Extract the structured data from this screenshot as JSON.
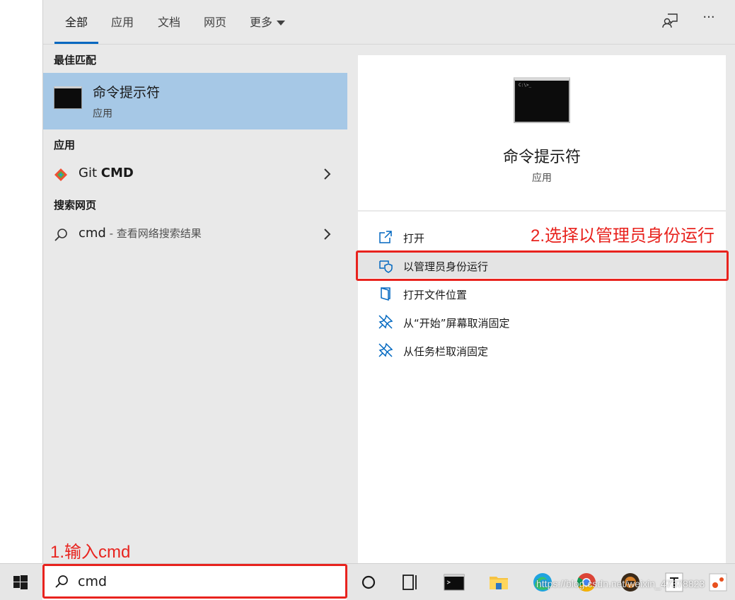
{
  "tabs": [
    {
      "label": "全部"
    },
    {
      "label": "应用"
    },
    {
      "label": "文档"
    },
    {
      "label": "网页"
    },
    {
      "label": "更多"
    }
  ],
  "header_icons": [
    "feedback-icon",
    "more-options-icon"
  ],
  "more_glyph": "···",
  "best_match": {
    "section_title": "最佳匹配",
    "name": "命令提示符",
    "type": "应用"
  },
  "apps": {
    "section_title": "应用",
    "items": [
      {
        "name_prefix": "Git ",
        "name_bold": "CMD"
      }
    ]
  },
  "web": {
    "section_title": "搜索网页",
    "items": [
      {
        "query": "cmd",
        "suffix": " - 查看网络搜索结果"
      }
    ]
  },
  "detail": {
    "name": "命令提示符",
    "type": "应用",
    "icon_text": "C:\\>_",
    "actions": [
      {
        "label": "打开",
        "icon": "open-icon"
      },
      {
        "label": "以管理员身份运行",
        "icon": "shield-icon"
      },
      {
        "label": "打开文件位置",
        "icon": "file-location-icon"
      },
      {
        "label": "从“开始”屏幕取消固定",
        "icon": "unpin-icon"
      },
      {
        "label": "从任务栏取消固定",
        "icon": "unpin-icon"
      }
    ]
  },
  "annotations": {
    "step1": "1.输入cmd",
    "step2": "2.选择以管理员身份运行",
    "color": "#e8231e"
  },
  "search": {
    "value": "cmd"
  },
  "taskbar": {
    "apps": [
      "cortana-icon",
      "task-view-icon",
      "terminal-icon",
      "file-explorer-icon",
      "edge-icon",
      "chrome-icon",
      "game-app-icon",
      "typora-icon",
      "app-icon"
    ],
    "watermark": "https://blog.csdn.net/weixin_47378823"
  },
  "colors": {
    "selected": "#a6c8e6",
    "accent": "#0067c0",
    "panel": "#e9e9e9"
  }
}
